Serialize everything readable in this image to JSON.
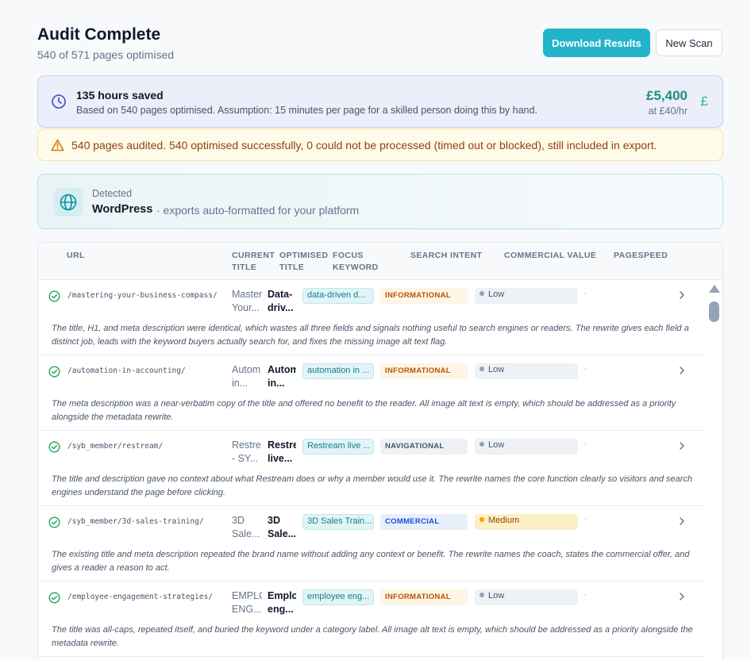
{
  "header": {
    "title": "Audit Complete",
    "subtitle": "540 of 571 pages optimised",
    "download_label": "Download Results",
    "new_scan_label": "New Scan"
  },
  "savings": {
    "headline": "135 hours saved",
    "detail": "Based on 540 pages optimised. Assumption: 15 minutes per page for a skilled person doing this by hand.",
    "amount": "£5,400",
    "rate": "at £40/hr",
    "currency_symbol": "£",
    "icon": "clock-icon"
  },
  "warning": {
    "text": "540 pages audited. 540 optimised successfully, 0 could not be processed (timed out or blocked), still included in export.",
    "icon": "warning-triangle-icon"
  },
  "detected": {
    "label": "Detected",
    "platform": "WordPress",
    "suffix": "· exports auto-formatted for your platform",
    "icon": "globe-icon"
  },
  "table": {
    "columns": {
      "url": "URL",
      "current_title": [
        "CURRENT",
        "TITLE"
      ],
      "optimised_title": [
        "OPTIMISED",
        "TITLE"
      ],
      "focus_keyword": [
        "FOCUS",
        "KEYWORD"
      ],
      "search_intent": "SEARCH INTENT",
      "commercial_value": "COMMERCIAL VALUE",
      "pagespeed": "PAGESPEED"
    },
    "rows": [
      {
        "url": "/mastering-your-business-compass/",
        "current": [
          "Master",
          "Your..."
        ],
        "optimised": [
          "Data-",
          "driv..."
        ],
        "keyword": "data-driven d...",
        "intent": "INFORMATIONAL",
        "value": "Low",
        "pagespeed": "-",
        "note": "The title, H1, and meta description were identical, which wastes all three fields and signals nothing useful to search engines or readers. The rewrite gives each field a distinct job, leads with the keyword buyers actually search for, and fixes the missing image alt text flag."
      },
      {
        "url": "/automation-in-accounting/",
        "current": [
          "Autom",
          "in..."
        ],
        "optimised": [
          "Autom",
          "in..."
        ],
        "keyword": "automation in ...",
        "intent": "INFORMATIONAL",
        "value": "Low",
        "pagespeed": "-",
        "note": "The meta description was a near-verbatim copy of the title and offered no benefit to the reader. All image alt text is empty, which should be addressed as a priority alongside the metadata rewrite."
      },
      {
        "url": "/syb_member/restream/",
        "current": [
          "Restre",
          "- SY..."
        ],
        "optimised": [
          "Restre",
          "live..."
        ],
        "keyword": "Restream live ...",
        "intent": "NAVIGATIONAL",
        "value": "Low",
        "pagespeed": "-",
        "note": "The title and description gave no context about what Restream does or why a member would use it. The rewrite names the core function clearly so visitors and search engines understand the page before clicking."
      },
      {
        "url": "/syb_member/3d-sales-training/",
        "current": [
          "3D",
          "Sale..."
        ],
        "optimised": [
          "3D",
          "Sale..."
        ],
        "keyword": "3D Sales Train...",
        "intent": "COMMERCIAL",
        "value": "Medium",
        "pagespeed": "-",
        "note": "The existing title and meta description repeated the brand name without adding any context or benefit. The rewrite names the coach, states the commercial offer, and gives a reader a reason to act."
      },
      {
        "url": "/employee-engagement-strategies/",
        "current": [
          "EMPLC",
          "ENG..."
        ],
        "optimised": [
          "Emplo",
          "eng..."
        ],
        "keyword": "employee eng...",
        "intent": "INFORMATIONAL",
        "value": "Low",
        "pagespeed": "-",
        "note": "The title was all-caps, repeated itself, and buried the keyword under a category label. All image alt text is empty, which should be addressed as a priority alongside the metadata rewrite."
      }
    ]
  },
  "colors": {
    "accent": "#22b5c9",
    "informational_bg": "#fef5e4",
    "informational_fg": "#b45309",
    "navigational_bg": "#eef1f5",
    "navigational_fg": "#475569",
    "commercial_bg": "#e8f0fc",
    "commercial_fg": "#1d4ed8",
    "low_bg": "#eef1f5",
    "low_dot": "#94a3b8",
    "medium_bg": "#fdf0c4",
    "medium_dot": "#f59e0b",
    "success": "#22a559"
  }
}
